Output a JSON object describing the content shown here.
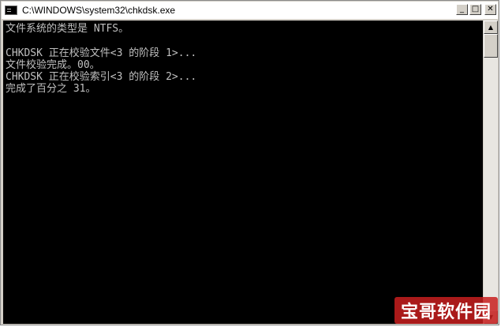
{
  "window": {
    "title": "C:\\WINDOWS\\system32\\chkdsk.exe",
    "icon": "console-icon",
    "buttons": {
      "minimize": "_",
      "maximize": "□",
      "close": "✕"
    }
  },
  "console": {
    "lines": [
      "文件系统的类型是 NTFS。",
      "",
      "CHKDSK 正在校验文件<3 的阶段 1>...",
      "文件校验完成。00。",
      "CHKDSK 正在校验索引<3 的阶段 2>...",
      "完成了百分之 31。"
    ]
  },
  "scrollbar": {
    "up_arrow": "▲",
    "down_arrow": "▼"
  },
  "watermark": {
    "text": "宝哥软件园"
  },
  "colors": {
    "console_bg": "#000000",
    "console_text": "#c0c0c0",
    "titlebar_bg": "#ffffff",
    "watermark_bg": "#c81e1e"
  }
}
